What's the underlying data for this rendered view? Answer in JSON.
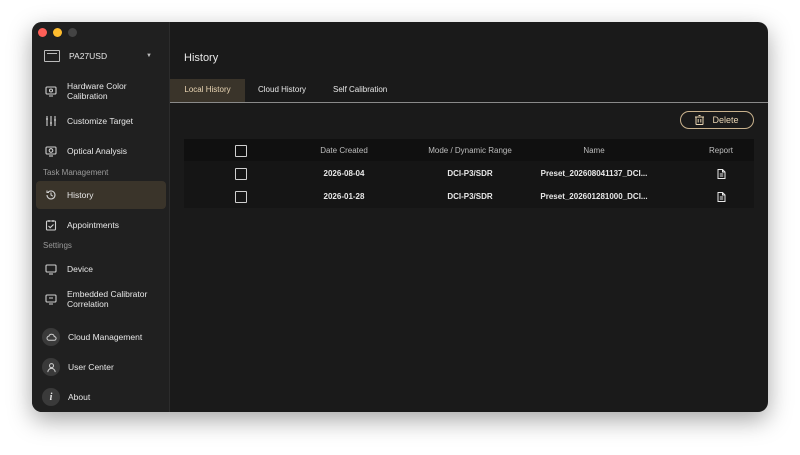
{
  "sidebar": {
    "device": "PA27USD",
    "items": [
      {
        "label": "Hardware Color Calibration",
        "icon": "monitor-calibration-icon"
      },
      {
        "label": "Customize Target",
        "icon": "sliders-icon"
      },
      {
        "label": "Optical Analysis",
        "icon": "monitor-analysis-icon"
      },
      {
        "label": "History",
        "icon": "history-icon"
      },
      {
        "label": "Appointments",
        "icon": "calendar-icon"
      },
      {
        "label": "Device",
        "icon": "monitor-icon"
      },
      {
        "label": "Embedded Calibrator Correlation",
        "icon": "monitor-correlation-icon"
      },
      {
        "label": "Cloud Management",
        "icon": "cloud-icon"
      },
      {
        "label": "User Center",
        "icon": "user-icon"
      },
      {
        "label": "About",
        "icon": "info-icon"
      }
    ],
    "sections": {
      "task_management": "Task Management",
      "settings": "Settings"
    }
  },
  "main": {
    "title": "History",
    "tabs": [
      {
        "label": "Local History"
      },
      {
        "label": "Cloud History"
      },
      {
        "label": "Self Calibration"
      }
    ],
    "active_tab": "Local History",
    "delete_label": "Delete"
  },
  "table": {
    "columns": [
      "Date Created",
      "Mode / Dynamic Range",
      "Name",
      "Report"
    ],
    "rows": [
      {
        "date": "2026-08-04",
        "mode": "DCI-P3/SDR",
        "name": "Preset_202608041137_DCI..."
      },
      {
        "date": "2026-01-28",
        "mode": "DCI-P3/SDR",
        "name": "Preset_202601281000_DCI..."
      }
    ]
  },
  "colors": {
    "accent": "#e9d5b3",
    "active_bg": "#3a342a",
    "background": "#1a1a1a"
  }
}
